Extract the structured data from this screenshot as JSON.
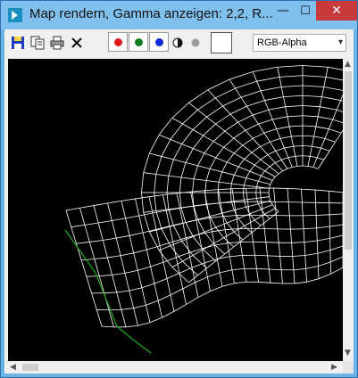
{
  "window": {
    "title": "Map rendern, Gamma anzeigen: 2,2, R...",
    "minimize_glyph": "—",
    "maximize_glyph": "☐",
    "close_glyph": "✕"
  },
  "toolbar": {
    "icons": [
      "save-icon",
      "copy-icon",
      "print-icon",
      "clear-icon"
    ],
    "channels": [
      {
        "name": "red-channel",
        "color": "#e0181c"
      },
      {
        "name": "green-channel",
        "color": "#0f7d1e"
      },
      {
        "name": "blue-channel",
        "color": "#1027d8"
      }
    ],
    "display_mode": {
      "selected": "RGB-Alpha"
    }
  },
  "viewport": {
    "background": "#000000",
    "wire_color": "#ffffff",
    "edge_color": "#1fa81f"
  }
}
